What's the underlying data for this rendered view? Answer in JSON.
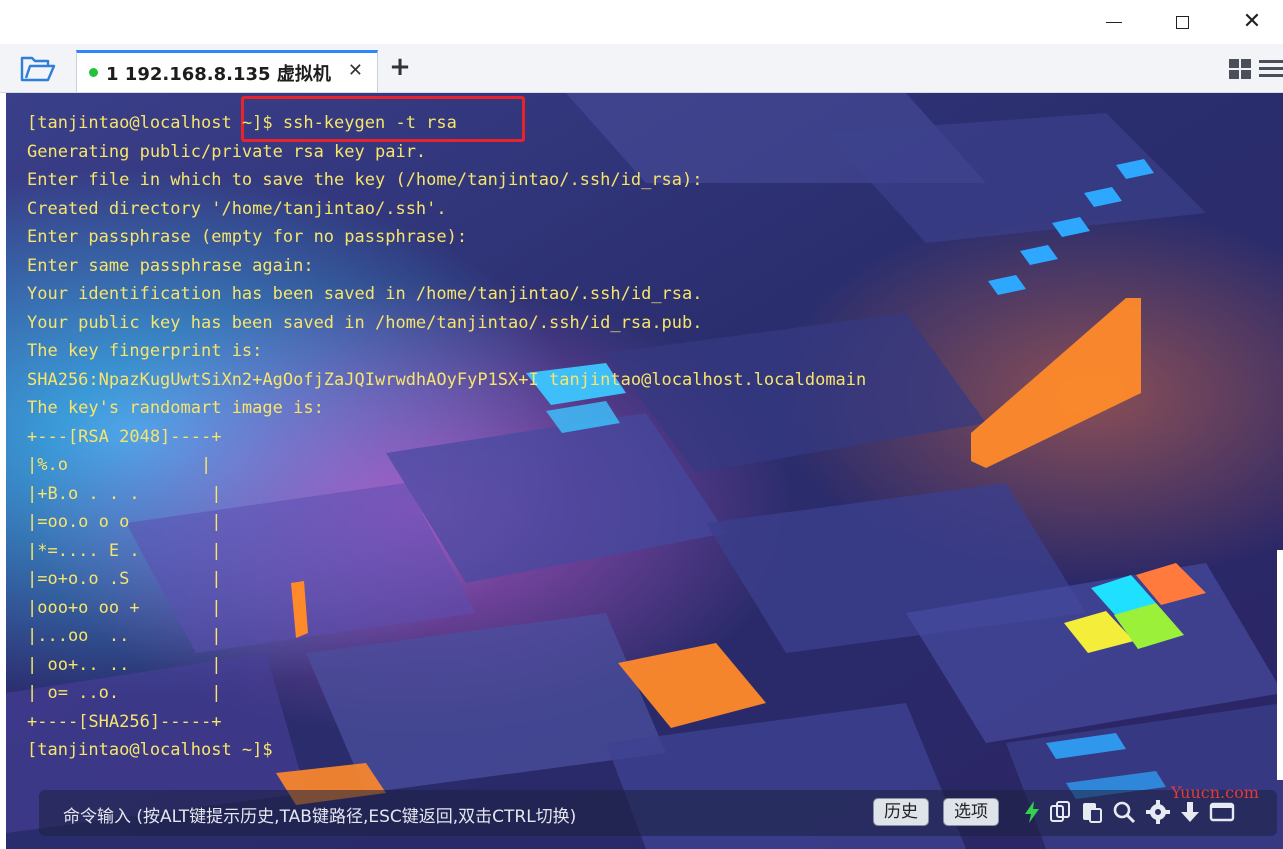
{
  "window": {
    "minimize_label": "—",
    "close_label": "✕"
  },
  "tabs": {
    "active_tab_label": "1 192.168.8.135  虚拟机",
    "active_tab_status_color": "#25c13a",
    "close_label": "✕",
    "add_label": "+"
  },
  "terminal": {
    "text_color": "#f7e56b",
    "lines": [
      "[tanjintao@localhost ~]$ ssh-keygen -t rsa",
      "Generating public/private rsa key pair.",
      "Enter file in which to save the key (/home/tanjintao/.ssh/id_rsa):",
      "Created directory '/home/tanjintao/.ssh'.",
      "Enter passphrase (empty for no passphrase):",
      "Enter same passphrase again:",
      "Your identification has been saved in /home/tanjintao/.ssh/id_rsa.",
      "Your public key has been saved in /home/tanjintao/.ssh/id_rsa.pub.",
      "The key fingerprint is:",
      "SHA256:NpazKugUwtSiXn2+AgOofjZaJQIwrwdhAOyFyP1SX+I tanjintao@localhost.localdomain",
      "The key's randomart image is:",
      "+---[RSA 2048]----+",
      "|%.o             |",
      "|+B.o . . .       |",
      "|=oo.o o o        |",
      "|*=.... E .       |",
      "|=o+o.o .S        |",
      "|ooo+o oo +       |",
      "|...oo  ..        |",
      "| oo+.. ..        |",
      "| o= ..o.         |",
      "+----[SHA256]-----+",
      "[tanjintao@localhost ~]$"
    ],
    "highlight_color": "#e8232a"
  },
  "command_bar": {
    "placeholder": "命令输入 (按ALT键提示历史,TAB键路径,ESC键返回,双击CTRL切换)",
    "history_label": "历史",
    "options_label": "选项",
    "tool_icons": [
      "lightning-icon",
      "copy-icon",
      "paste-icon",
      "search-icon",
      "gear-icon",
      "download-icon",
      "window-icon"
    ]
  },
  "watermark": {
    "text": "Yuucn.com"
  }
}
